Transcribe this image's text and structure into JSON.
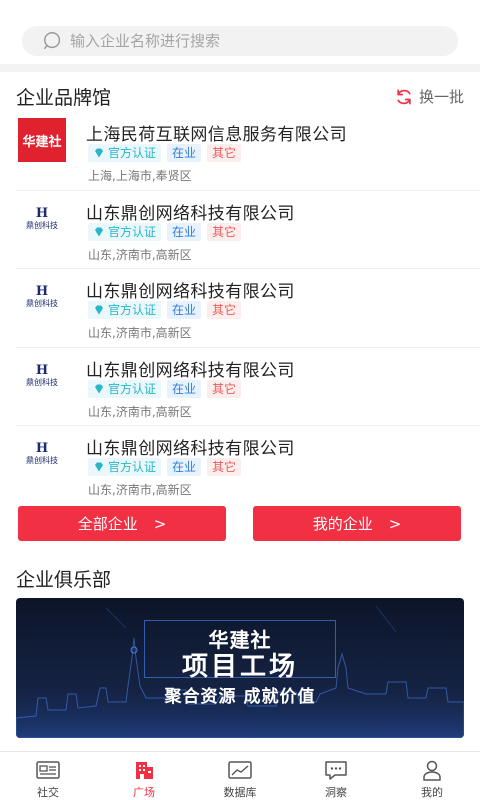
{
  "search": {
    "placeholder": "输入企业名称进行搜索"
  },
  "brand_section": {
    "title": "企业品牌馆",
    "refresh_label": "换一批",
    "companies": [
      {
        "logo_text": "华建社",
        "name": "上海民荷互联网信息服务有限公司",
        "cert": "官方认证",
        "status": "在业",
        "type": "其它",
        "address": "上海,上海市,奉贤区"
      },
      {
        "logo_text": "鼎创科技",
        "name": "山东鼎创网络科技有限公司",
        "cert": "官方认证",
        "status": "在业",
        "type": "其它",
        "address": "山东,济南市,高新区"
      },
      {
        "logo_text": "鼎创科技",
        "name": "山东鼎创网络科技有限公司",
        "cert": "官方认证",
        "status": "在业",
        "type": "其它",
        "address": "山东,济南市,高新区"
      },
      {
        "logo_text": "鼎创科技",
        "name": "山东鼎创网络科技有限公司",
        "cert": "官方认证",
        "status": "在业",
        "type": "其它",
        "address": "山东,济南市,高新区"
      },
      {
        "logo_text": "鼎创科技",
        "name": "山东鼎创网络科技有限公司",
        "cert": "官方认证",
        "status": "在业",
        "type": "其它",
        "address": "山东,济南市,高新区"
      }
    ],
    "all_button": "全部企业",
    "mine_button": "我的企业",
    "arrow": ">"
  },
  "club_section": {
    "title": "企业俱乐部",
    "banner_brand": "华建社",
    "banner_title": "项目工场",
    "banner_sub": "聚合资源 成就价值"
  },
  "tabbar": [
    {
      "label": "社交",
      "icon": "news-icon"
    },
    {
      "label": "广场",
      "icon": "building-icon"
    },
    {
      "label": "数据库",
      "icon": "chart-icon"
    },
    {
      "label": "洞察",
      "icon": "message-icon"
    },
    {
      "label": "我的",
      "icon": "user-icon"
    }
  ],
  "colors": {
    "accent": "#f23044",
    "cert": "#29b6c9",
    "status": "#2f7fd6",
    "type": "#ee5a5a"
  }
}
